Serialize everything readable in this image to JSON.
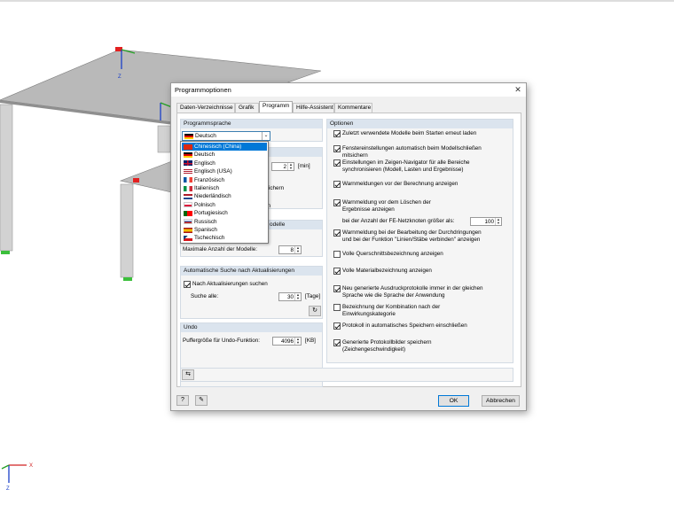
{
  "dialog": {
    "title": "Programmoptionen",
    "close_symbol": "✕",
    "tabs": [
      "Daten-Verzeichnisse",
      "Grafik",
      "Programm",
      "Hilfe-Assistent",
      "Kommentare"
    ],
    "active_tab": "Programm"
  },
  "left": {
    "language_group": {
      "header": "Programmsprache",
      "selected": "Deutsch"
    },
    "languages": [
      {
        "label": "Chinesisch  (China)",
        "flag": "cn",
        "selected": true
      },
      {
        "label": "Deutsch",
        "flag": "de"
      },
      {
        "label": "Englisch",
        "flag": "uk"
      },
      {
        "label": "Englisch (USA)",
        "flag": "us"
      },
      {
        "label": "Französisch",
        "flag": "fr"
      },
      {
        "label": "Italienisch",
        "flag": "it"
      },
      {
        "label": "Niederländisch",
        "flag": "nl"
      },
      {
        "label": "Polnisch",
        "flag": "pl"
      },
      {
        "label": "Portugiesisch",
        "flag": "pt"
      },
      {
        "label": "Russisch",
        "flag": "ru"
      },
      {
        "label": "Spanisch",
        "flag": "es"
      },
      {
        "label": "Tschechisch",
        "flag": "cz"
      }
    ],
    "hidden_group": {
      "spin_value": "2",
      "spin_unit": "[min]",
      "partial_text_1": "peichern",
      "partial_text_2": "ern"
    },
    "models_group": {
      "header_partial": "odelle",
      "max_models_label": "Maximale Anzahl der Modelle:",
      "max_models_value": "8"
    },
    "update_group": {
      "header": "Automatische Suche nach Aktualisierungen",
      "check_label": "Nach Aktualisierungen suchen",
      "search_label": "Suche alle:",
      "search_value": "30",
      "search_unit": "[Tage]"
    },
    "undo_group": {
      "header": "Undo",
      "buffer_label": "Puffergröße für Undo-Funktion:",
      "buffer_value": "4096",
      "buffer_unit": "[KB]"
    }
  },
  "right": {
    "header": "Optionen",
    "options": [
      {
        "label": "Zuletzt verwendete Modelle beim Starten erneut laden",
        "checked": true
      },
      {
        "label": "Fenstereinstellungen automatisch beim Modellschließen",
        "label2": "mitsichern",
        "checked": true
      },
      {
        "label": "Einstellungen im Zeigen-Navigator für alle Bereiche",
        "label2": "synchronisieren (Modell, Lasten und Ergebnisse)",
        "checked": true
      },
      {
        "label": "Warnmeldungen vor der Berechnung anzeigen",
        "checked": true
      },
      {
        "label": "Warnmeldung vor dem Löschen der",
        "label2": "Ergebnisse anzeigen",
        "checked": true
      },
      {
        "label": "Warnmeldung bei der Bearbeitung der Durchdringungen",
        "label2": "und bei der Funktion \"Linien/Stäbe verbinden\" anzeigen",
        "checked": true
      },
      {
        "label": "Volle Querschnittsbezeichnung anzeigen",
        "checked": false
      },
      {
        "label": "Volle Materialbezeichnung anzeigen",
        "checked": true
      },
      {
        "label": "Neu generierte Ausdruckprotokolle immer in der gleichen",
        "label2": "Sprache wie die Sprache der Anwendung",
        "checked": true
      },
      {
        "label": "Bezeichnung der Kombination nach der",
        "label2": "Einwirkungskategorie",
        "checked": false
      },
      {
        "label": "Protokoll in automatisches Speichern einschließen",
        "checked": true
      },
      {
        "label": "Generierte Protokollbilder speichern",
        "label2": "(Zeichengeschwindigkeit)",
        "checked": true
      }
    ],
    "fe_nodes_label": "bei der Anzahl der FE-Netzknoten größer als:",
    "fe_nodes_value": "100"
  },
  "buttons": {
    "ok": "OK",
    "cancel": "Abbrechen"
  },
  "scene": {
    "axis_z": "Z",
    "axis_x": "X",
    "axis_z2": "Z"
  }
}
